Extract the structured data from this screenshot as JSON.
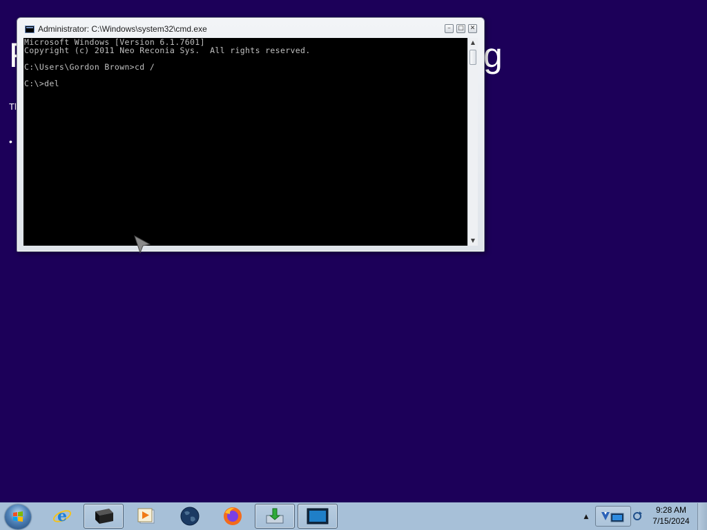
{
  "background_page": {
    "heading_left": "F",
    "heading_right": "g",
    "para_fragment": "Tl",
    "bullet": "•"
  },
  "cmd_window": {
    "title": "Administrator: C:\\Windows\\system32\\cmd.exe",
    "min_glyph": "–",
    "max_glyph": "□",
    "close_glyph": "✕",
    "lines": [
      "Microsoft Windows [Version 6.1.7601]",
      "Copyright (c) 2011 Neo Reconia Sys.  All rights reserved.",
      "",
      "C:\\Users\\Gordon Brown>cd /",
      "",
      "C:\\>del"
    ],
    "scroll_up_glyph": "▲",
    "scroll_down_glyph": "▼"
  },
  "taskbar": {
    "start_label": "Start",
    "items": [
      {
        "name": "internet-explorer",
        "icon": "ie-icon"
      },
      {
        "name": "cmd-black",
        "icon": "terminal-icon",
        "active": true
      },
      {
        "name": "media-player",
        "icon": "media-player-icon"
      },
      {
        "name": "globe",
        "icon": "globe-icon"
      },
      {
        "name": "firefox",
        "icon": "firefox-icon"
      },
      {
        "name": "installer",
        "icon": "install-icon",
        "active": true
      },
      {
        "name": "cmd-window",
        "icon": "monitor-icon",
        "active": true
      }
    ],
    "tray_arrow_glyph": "▲",
    "clock_time": "9:28 AM",
    "clock_date": "7/15/2024"
  },
  "colors": {
    "desktop": "#1c0059",
    "taskbar": "#a7c0d8",
    "console_text": "#c0c0c0"
  }
}
